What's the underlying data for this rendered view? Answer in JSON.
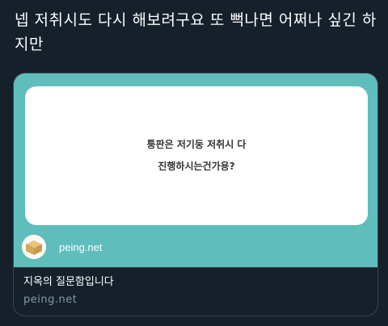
{
  "tweet": {
    "text": "넵 저취시도 다시 해보려구요 또 뻑나면 어쩌나 싶긴 하지만"
  },
  "card": {
    "question_lines": [
      "퉁판은 저기둥 저취시 다",
      "진행하시는건가용?"
    ],
    "brand": {
      "name": "peing.net",
      "avatar_icon": "peing-box-icon"
    },
    "title": "지옥의 질문함입니다",
    "domain": "peing.net"
  },
  "colors": {
    "background": "#15202b",
    "card_image_background": "#5fbdbc",
    "question_box": "#ffffff",
    "domain_text": "#8899a6"
  }
}
